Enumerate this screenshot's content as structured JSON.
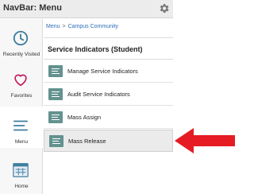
{
  "header": {
    "title": "NavBar: Menu",
    "settings_icon": "gear-icon"
  },
  "rail": {
    "items": [
      {
        "label": "Recently Visited",
        "icon": "clock-icon"
      },
      {
        "label": "Favorites",
        "icon": "heart-icon"
      },
      {
        "label": "Menu",
        "icon": "menu-lines-icon",
        "active": true
      },
      {
        "label": "Home",
        "icon": "grid-window-icon"
      }
    ]
  },
  "breadcrumb": {
    "root": "Menu",
    "separator": ">",
    "current": "Campus Community"
  },
  "section": {
    "title": "Service Indicators (Student)"
  },
  "menu_items": [
    {
      "label": "Manage Service Indicators"
    },
    {
      "label": "Audit Service Indicators"
    },
    {
      "label": "Mass Assign"
    },
    {
      "label": "Mass Release",
      "selected": true
    }
  ],
  "colors": {
    "accent_icon": "#63928f",
    "link": "#2a6ebb",
    "annotation_arrow": "#e51c23"
  }
}
